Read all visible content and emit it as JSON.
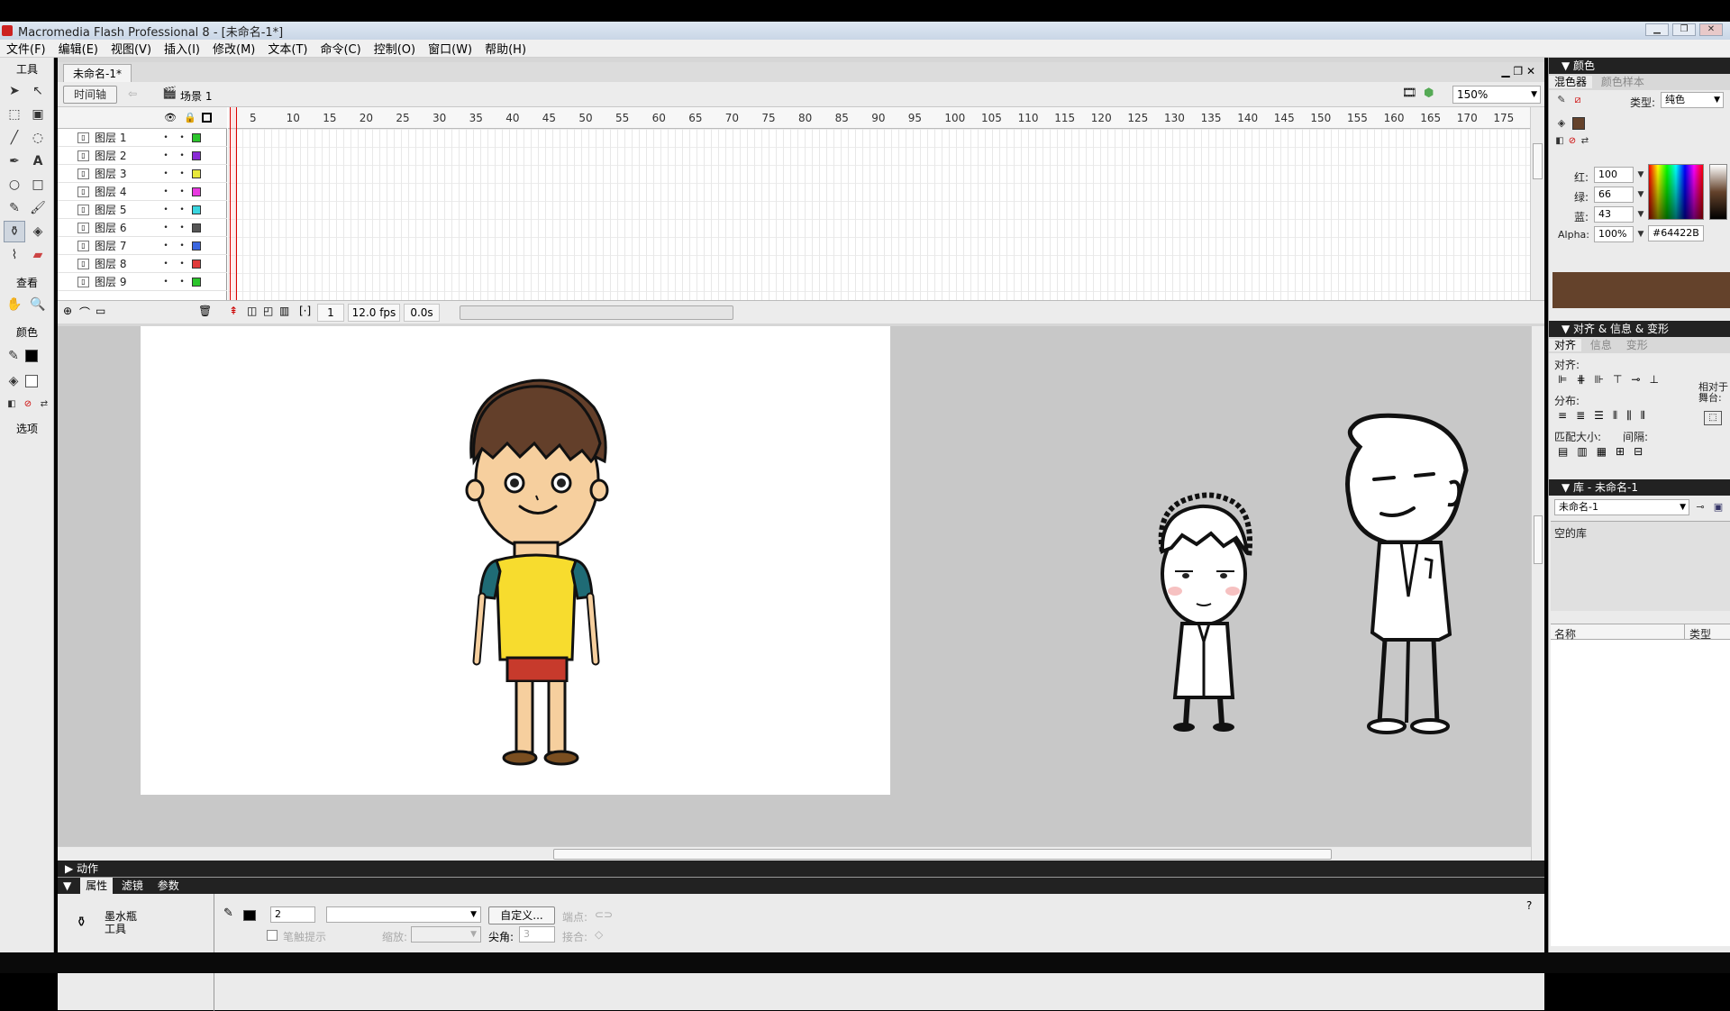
{
  "window": {
    "title": "Macromedia Flash Professional 8 - [未命名-1*]",
    "buttons": [
      "▁",
      "❐",
      "✕"
    ]
  },
  "menu": [
    "文件(F)",
    "编辑(E)",
    "视图(V)",
    "插入(I)",
    "修改(M)",
    "文本(T)",
    "命令(C)",
    "控制(O)",
    "窗口(W)",
    "帮助(H)"
  ],
  "tools": {
    "title": "工具",
    "view_label": "查看",
    "color_label": "颜色",
    "options_label": "选项",
    "icons": [
      "select-arrow-icon",
      "subselect-icon",
      "free-transform-icon",
      "fill-transform-icon",
      "line-icon",
      "lasso-icon",
      "pen-icon",
      "text-icon",
      "oval-icon",
      "rectangle-icon",
      "pencil-icon",
      "brush-icon",
      "ink-bottle-icon",
      "paint-bucket-icon",
      "eyedropper-icon",
      "eraser-icon"
    ],
    "view_icons": [
      "hand-icon",
      "zoom-icon"
    ]
  },
  "document": {
    "tab": "未命名-1*",
    "timeline_button": "时间轴",
    "scene": "场景 1",
    "zoom": "150%"
  },
  "timeline": {
    "ruler": [
      "5",
      "10",
      "15",
      "20",
      "25",
      "30",
      "35",
      "40",
      "45",
      "50",
      "55",
      "60",
      "65",
      "70",
      "75",
      "80",
      "85",
      "90",
      "95",
      "100",
      "105",
      "110",
      "115",
      "120",
      "125",
      "130",
      "135",
      "140",
      "145",
      "150",
      "155",
      "160",
      "165",
      "170",
      "175"
    ],
    "layers": [
      {
        "name": "图层 1",
        "color": "#2bc52b"
      },
      {
        "name": "图层 2",
        "color": "#8a2bd6"
      },
      {
        "name": "图层 3",
        "color": "#e8e83a"
      },
      {
        "name": "图层 4",
        "color": "#e83ae0"
      },
      {
        "name": "图层 5",
        "color": "#3ad6e0"
      },
      {
        "name": "图层 6",
        "color": "#555555"
      },
      {
        "name": "图层 7",
        "color": "#3a66e0"
      },
      {
        "name": "图层 8",
        "color": "#e03a3a"
      },
      {
        "name": "图层 9",
        "color": "#2bc52b"
      }
    ],
    "current_frame": "1",
    "fps": "12.0 fps",
    "time": "0.0s"
  },
  "panels": {
    "actions": "动作",
    "props_tabs": [
      "属性",
      "滤镜",
      "参数"
    ],
    "tool_name": "墨水瓶\n工具",
    "stroke_size": "2",
    "custom_button": "自定义...",
    "endpoint_label": "端点:",
    "stroke_hint": "笔触提示",
    "scale_label": "缩放:",
    "miter_label": "尖角:",
    "miter_value": "3",
    "join_label": "接合:"
  },
  "color_panel": {
    "title": "颜色",
    "tabs": [
      "混色器",
      "颜色样本"
    ],
    "type_label": "类型:",
    "type_value": "纯色",
    "red_label": "红:",
    "red": "100",
    "green_label": "绿:",
    "green": "66",
    "blue_label": "蓝:",
    "blue": "43",
    "alpha_label": "Alpha:",
    "alpha": "100%",
    "hex": "#64422B",
    "swatch_color": "#64422B"
  },
  "align_panel": {
    "title": "对齐 & 信息 & 变形",
    "tabs": [
      "对齐",
      "信息",
      "变形"
    ],
    "align_label": "对齐:",
    "distribute_label": "分布:",
    "match_label": "匹配大小:",
    "space_label": "间隔:",
    "relative_label": "相对于\n舞台:"
  },
  "library_panel": {
    "title": "库 - 未命名-1",
    "doc_select": "未命名-1",
    "empty": "空的库",
    "col_name": "名称",
    "col_type": "类型"
  }
}
